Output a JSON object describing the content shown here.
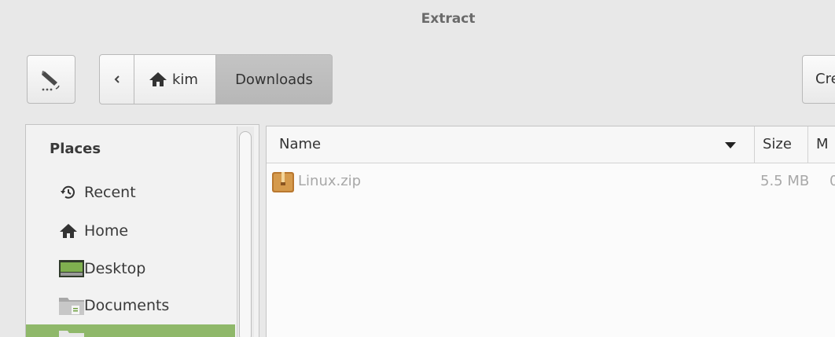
{
  "window": {
    "title": "Extract"
  },
  "toolbar": {
    "pathbar": {
      "home_label": "kim",
      "current_label": "Downloads"
    },
    "create_label": "Cre"
  },
  "sidebar": {
    "heading": "Places",
    "items": [
      {
        "label": "Recent",
        "icon": "recent-icon"
      },
      {
        "label": "Home",
        "icon": "home-icon"
      },
      {
        "label": "Desktop",
        "icon": "desktop-icon"
      },
      {
        "label": "Documents",
        "icon": "documents-icon"
      }
    ]
  },
  "filelist": {
    "columns": {
      "name": "Name",
      "size": "Size",
      "modified": "M"
    },
    "rows": [
      {
        "name": "Linux.zip",
        "size": "5.5 MB",
        "modified": "0"
      }
    ]
  },
  "colors": {
    "selected": "#8fb86a",
    "active_segment": "#b7b7b7"
  }
}
